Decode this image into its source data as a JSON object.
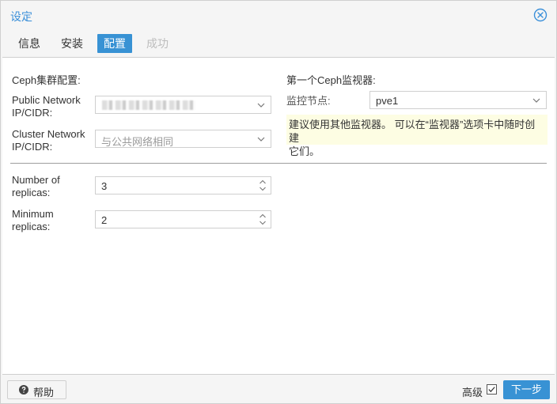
{
  "window": {
    "title": "设定"
  },
  "tabs": [
    {
      "label": "信息",
      "state": "normal"
    },
    {
      "label": "安装",
      "state": "normal"
    },
    {
      "label": "配置",
      "state": "active"
    },
    {
      "label": "成功",
      "state": "disabled"
    }
  ],
  "cluster_config": {
    "title": "Ceph集群配置:",
    "public_network": {
      "label_line1": "Public Network",
      "label_line2": "IP/CIDR:"
    },
    "cluster_network": {
      "label_line1": "Cluster Network",
      "label_line2": "IP/CIDR:",
      "placeholder": "与公共网络相同"
    },
    "replicas": {
      "label_line1": "Number of",
      "label_line2": "replicas:",
      "value": "3"
    },
    "min_replicas": {
      "label_line1": "Minimum",
      "label_line2": "replicas:",
      "value": "2"
    }
  },
  "monitor": {
    "title": "第一个Ceph监视器:",
    "node_label": "监控节点:",
    "node_value": "pve1",
    "hint_line1": "建议使用其他监视器。 可以在“监视器”选项卡中随时创建",
    "hint_line2": "它们。"
  },
  "footer": {
    "help_label": "帮助",
    "advanced_label": "高级",
    "advanced_checked": true,
    "next_label": "下一步"
  },
  "colors": {
    "accent": "#3892d4",
    "title": "#3a8fd9",
    "hint_bg": "#fdfde3"
  }
}
